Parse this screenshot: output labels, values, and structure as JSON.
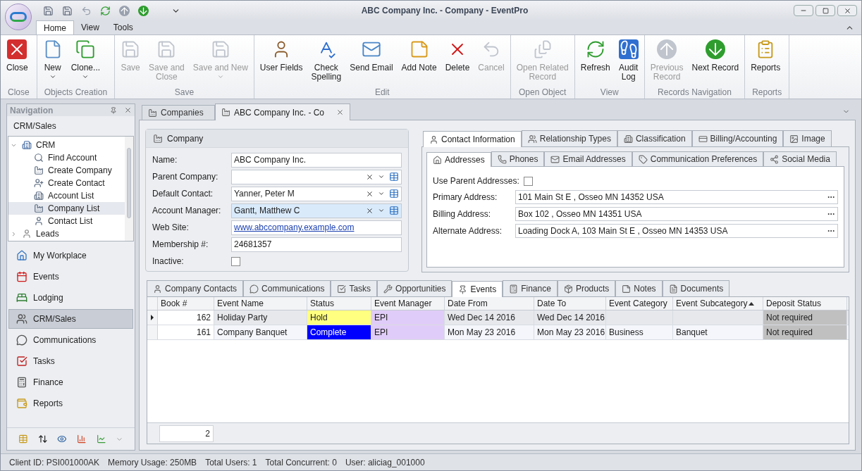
{
  "window": {
    "title": "ABC Company Inc. - Company - EventPro"
  },
  "ribbon_tabs": [
    {
      "label": "Home",
      "selected": true
    },
    {
      "label": "View",
      "selected": false
    },
    {
      "label": "Tools",
      "selected": false
    }
  ],
  "ribbon_groups": [
    {
      "label": "Close",
      "buttons": [
        {
          "lines": [
            "Close"
          ],
          "disabled": false,
          "dropdown": false
        }
      ]
    },
    {
      "label": "Objects Creation",
      "buttons": [
        {
          "lines": [
            "New"
          ],
          "disabled": false,
          "dropdown": true
        },
        {
          "lines": [
            "Clone..."
          ],
          "disabled": false,
          "dropdown": true
        }
      ]
    },
    {
      "label": "Save",
      "buttons": [
        {
          "lines": [
            "Save"
          ],
          "disabled": true,
          "dropdown": false
        },
        {
          "lines": [
            "Save and",
            "Close"
          ],
          "disabled": true,
          "dropdown": false
        },
        {
          "lines": [
            "Save and New"
          ],
          "disabled": true,
          "dropdown": true
        }
      ]
    },
    {
      "label": "Edit",
      "buttons": [
        {
          "lines": [
            "User Fields"
          ],
          "disabled": false,
          "dropdown": false
        },
        {
          "lines": [
            "Check",
            "Spelling"
          ],
          "disabled": false,
          "dropdown": false
        },
        {
          "lines": [
            "Send Email"
          ],
          "disabled": false,
          "dropdown": false
        },
        {
          "lines": [
            "Add Note"
          ],
          "disabled": false,
          "dropdown": false
        },
        {
          "lines": [
            "Delete"
          ],
          "disabled": false,
          "dropdown": false
        },
        {
          "lines": [
            "Cancel"
          ],
          "disabled": true,
          "dropdown": false
        }
      ]
    },
    {
      "label": "Open Object",
      "buttons": [
        {
          "lines": [
            "Open Related",
            "Record"
          ],
          "disabled": true,
          "dropdown": false
        }
      ]
    },
    {
      "label": "View",
      "buttons": [
        {
          "lines": [
            "Refresh"
          ],
          "disabled": false,
          "dropdown": false
        },
        {
          "lines": [
            "Audit",
            "Log"
          ],
          "disabled": false,
          "dropdown": false
        }
      ]
    },
    {
      "label": "Records Navigation",
      "buttons": [
        {
          "lines": [
            "Previous",
            "Record"
          ],
          "disabled": true,
          "dropdown": false
        },
        {
          "lines": [
            "Next Record"
          ],
          "disabled": false,
          "dropdown": false
        }
      ]
    },
    {
      "label": "Reports",
      "buttons": [
        {
          "lines": [
            "Reports"
          ],
          "disabled": false,
          "dropdown": false
        }
      ]
    }
  ],
  "navigation": {
    "title": "Navigation",
    "section": "CRM/Sales",
    "tree": [
      {
        "label": "CRM",
        "expanded": true,
        "selected": false,
        "children": [
          {
            "label": "Find Account",
            "selected": false
          },
          {
            "label": "Create Company",
            "selected": false
          },
          {
            "label": "Create Contact",
            "selected": false
          },
          {
            "label": "Account List",
            "selected": false
          },
          {
            "label": "Company List",
            "selected": true
          },
          {
            "label": "Contact List",
            "selected": false
          }
        ]
      },
      {
        "label": "Leads",
        "expanded": false,
        "selected": false
      }
    ],
    "items": [
      {
        "label": "My Workplace",
        "selected": false
      },
      {
        "label": "Events",
        "selected": false
      },
      {
        "label": "Lodging",
        "selected": false
      },
      {
        "label": "CRM/Sales",
        "selected": true
      },
      {
        "label": "Communications",
        "selected": false
      },
      {
        "label": "Tasks",
        "selected": false
      },
      {
        "label": "Finance",
        "selected": false
      },
      {
        "label": "Reports",
        "selected": false
      }
    ]
  },
  "doc_tabs": [
    {
      "label": "Companies",
      "selected": false,
      "closable": false
    },
    {
      "label": "ABC Company Inc. - Co",
      "selected": true,
      "closable": true
    }
  ],
  "company": {
    "title": "Company",
    "fields": [
      {
        "kind": "text",
        "label": "Name:",
        "value": "ABC Company Inc."
      },
      {
        "kind": "lookup",
        "label": "Parent Company:"
      },
      {
        "kind": "lookup",
        "label": "Default Contact:",
        "value": "Yanner, Peter M"
      },
      {
        "kind": "lookup",
        "label": "Account Manager:",
        "value": "Gantt, Matthew C",
        "focused": true
      },
      {
        "kind": "link",
        "label": "Web Site:",
        "value": "www.abccompany.example.com"
      },
      {
        "kind": "text",
        "label": "Membership #:",
        "value": "24681357"
      },
      {
        "kind": "checkbox",
        "label": "Inactive:",
        "checked": false
      }
    ]
  },
  "info_tabs": [
    {
      "label": "Contact Information",
      "selected": true
    },
    {
      "label": "Relationship Types",
      "selected": false
    },
    {
      "label": "Classification",
      "selected": false
    },
    {
      "label": "Billing/Accounting",
      "selected": false
    },
    {
      "label": "Image",
      "selected": false
    }
  ],
  "address_tabs": [
    {
      "label": "Addresses",
      "selected": true
    },
    {
      "label": "Phones",
      "selected": false
    },
    {
      "label": "Email Addresses",
      "selected": false
    },
    {
      "label": "Communication Preferences",
      "selected": false
    },
    {
      "label": "Social Media",
      "selected": false
    }
  ],
  "addresses": {
    "use_parent": {
      "label": "Use Parent Addresses:",
      "checked": false
    },
    "fields": [
      {
        "label": "Primary Address:",
        "value": "101 Main St E , Osseo MN 14352 USA"
      },
      {
        "label": "Billing Address:",
        "value": "Box 102 , Osseo MN 14351 USA"
      },
      {
        "label": "Alternate Address:",
        "value": "Loading Dock A, 103 Main St E , Osseo MN 14353 USA"
      }
    ]
  },
  "detail_tabs": [
    {
      "label": "Company Contacts",
      "selected": false
    },
    {
      "label": "Communications",
      "selected": false
    },
    {
      "label": "Tasks",
      "selected": false
    },
    {
      "label": "Opportunities",
      "selected": false
    },
    {
      "label": "Events",
      "selected": true
    },
    {
      "label": "Finance",
      "selected": false
    },
    {
      "label": "Products",
      "selected": false
    },
    {
      "label": "Notes",
      "selected": false
    },
    {
      "label": "Documents",
      "selected": false
    }
  ],
  "events_table": {
    "columns": [
      {
        "label": "Book #",
        "sorted": false
      },
      {
        "label": "Event Name",
        "sorted": false
      },
      {
        "label": "Status",
        "sorted": false
      },
      {
        "label": "Event Manager",
        "sorted": false
      },
      {
        "label": "Date From",
        "sorted": false
      },
      {
        "label": "Date To",
        "sorted": false
      },
      {
        "label": "Event Category",
        "sorted": false
      },
      {
        "label": "Event Subcategory",
        "sorted": true
      },
      {
        "label": "Deposit Status",
        "sorted": false
      }
    ],
    "rows": [
      {
        "selected": true,
        "cells": [
          {
            "text": "162"
          },
          {
            "text": "Holiday Party"
          },
          {
            "text": "Hold",
            "color": "#ffff80"
          },
          {
            "text": "EPI",
            "color": "#e0ccf8"
          },
          {
            "text": "Wed Dec 14 2016"
          },
          {
            "text": "Wed Dec 14 2016"
          },
          {
            "text": ""
          },
          {
            "text": ""
          },
          {
            "text": "Not required",
            "color": "#c0c0c0"
          }
        ]
      },
      {
        "selected": false,
        "cells": [
          {
            "text": "161"
          },
          {
            "text": "Company Banquet"
          },
          {
            "text": "Complete",
            "color": "#0000ff"
          },
          {
            "text": "EPI",
            "color": "#e0ccf8"
          },
          {
            "text": "Mon May 23 2016"
          },
          {
            "text": "Mon May 23 2016"
          },
          {
            "text": "Business"
          },
          {
            "text": "Banquet"
          },
          {
            "text": "Not required",
            "color": "#c0c0c0"
          }
        ]
      }
    ],
    "footer_count": "2"
  },
  "status_bar": [
    "Client ID: PSI001000AK",
    "Memory Usage: 250MB",
    "Total Users: 1",
    "Total Concurrent: 0",
    "User: aliciag_001000"
  ]
}
